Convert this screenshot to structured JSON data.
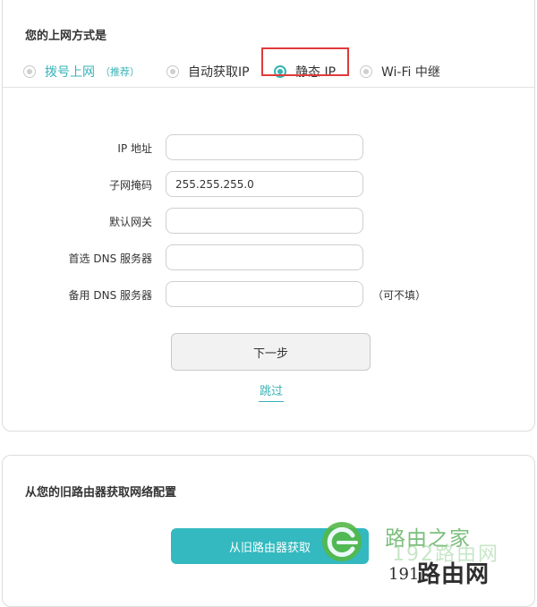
{
  "connection": {
    "title": "您的上网方式是",
    "options": [
      {
        "label": "拨号上网",
        "note": "（推荐）"
      },
      {
        "label": "自动获取IP"
      },
      {
        "label": "静态 IP"
      },
      {
        "label": "Wi-Fi 中继"
      }
    ],
    "selected": "静态 IP"
  },
  "form": {
    "ip_label": "IP 地址",
    "ip_value": "",
    "subnet_label": "子网掩码",
    "subnet_value": "255.255.255.0",
    "gateway_label": "默认网关",
    "gateway_value": "",
    "dns1_label": "首选 DNS 服务器",
    "dns1_value": "",
    "dns2_label": "备用 DNS 服务器",
    "dns2_value": "",
    "optional_note": "（可不填）"
  },
  "actions": {
    "next_label": "下一步",
    "skip_label": "跳过"
  },
  "old_router": {
    "title": "从您的旧路由器获取网络配置",
    "button_label": "从旧路由器获取"
  },
  "watermark": {
    "text1": "路由之家",
    "ghost": "192路由网",
    "number": "191",
    "text2": "路由网"
  },
  "colors": {
    "accent": "#35b3b3",
    "highlight_border": "#e03a3a",
    "primary_button": "#33b9bf"
  }
}
